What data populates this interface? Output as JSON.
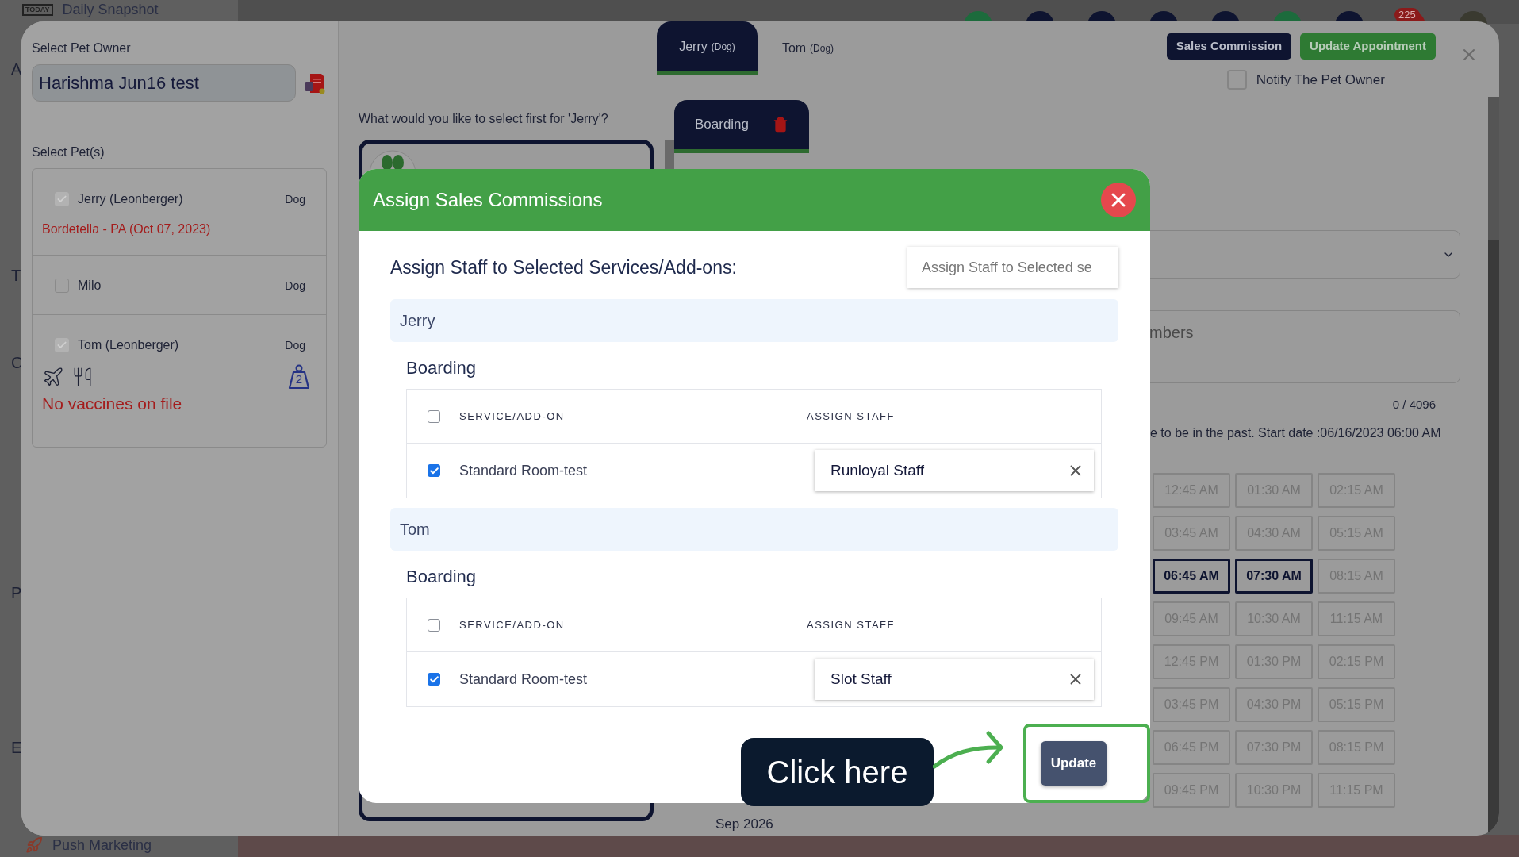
{
  "background": {
    "today_badge": "TODAY",
    "top_item": "Daily Snapshot",
    "sidebar_fragments": [
      "A",
      "T",
      "C",
      "P",
      "E"
    ],
    "bottom_item": "Push Marketing",
    "notification_count": "225"
  },
  "owner_panel": {
    "owner_label": "Select Pet Owner",
    "owner_value": "Harishma Jun16 test",
    "pets_label": "Select Pet(s)",
    "pets": [
      {
        "name": "Jerry (Leonberger)",
        "species": "Dog",
        "checked": true,
        "note": "Bordetella - PA (Oct 07, 2023)",
        "kind": "vaccinated"
      },
      {
        "name": "Milo",
        "species": "Dog",
        "checked": false,
        "kind": "basic"
      },
      {
        "name": "Tom (Leonberger)",
        "species": "Dog",
        "checked": true,
        "weight_badge": "2",
        "note": "No vaccines on file",
        "kind": "unvaccinated"
      }
    ]
  },
  "pet_tabs": [
    {
      "name": "Jerry",
      "species": "(Dog)",
      "selected": true
    },
    {
      "name": "Tom",
      "species": "(Dog)",
      "selected": false
    }
  ],
  "header_buttons": [
    {
      "label": "Sales Commission",
      "kind": "primary"
    },
    {
      "label": "Update Appointment",
      "kind": "success"
    }
  ],
  "notify": {
    "label": "Notify The Pet Owner",
    "checked": false
  },
  "question": "What would you like to select first for 'Jerry'?",
  "service_tabs": [
    {
      "label": "Boarding",
      "selected": true
    }
  ],
  "notes_placeholder": "mbers",
  "char_count": "0 / 4096",
  "warning": "e to be in the past. Start date :06/16/2023 06:00 AM",
  "time_slots": [
    {
      "label": "12:45 AM",
      "selected": false
    },
    {
      "label": "01:30 AM",
      "selected": false
    },
    {
      "label": "02:15 AM",
      "selected": false
    },
    {
      "label": "03:45 AM",
      "selected": false
    },
    {
      "label": "04:30 AM",
      "selected": false
    },
    {
      "label": "05:15 AM",
      "selected": false
    },
    {
      "label": "06:45 AM",
      "selected": true
    },
    {
      "label": "07:30 AM",
      "selected": true
    },
    {
      "label": "08:15 AM",
      "selected": false
    },
    {
      "label": "09:45 AM",
      "selected": false
    },
    {
      "label": "10:30 AM",
      "selected": false
    },
    {
      "label": "11:15 AM",
      "selected": false
    },
    {
      "label": "12:45 PM",
      "selected": false
    },
    {
      "label": "01:30 PM",
      "selected": false
    },
    {
      "label": "02:15 PM",
      "selected": false
    },
    {
      "label": "03:45 PM",
      "selected": false
    },
    {
      "label": "04:30 PM",
      "selected": false
    },
    {
      "label": "05:15 PM",
      "selected": false
    },
    {
      "label": "06:45 PM",
      "selected": false
    },
    {
      "label": "07:30 PM",
      "selected": false
    },
    {
      "label": "08:15 PM",
      "selected": false
    },
    {
      "label": "09:45 PM",
      "selected": false
    },
    {
      "label": "10:30 PM",
      "selected": false
    },
    {
      "label": "11:15 PM",
      "selected": false
    }
  ],
  "calendar_month": "Sep 2026",
  "modal": {
    "title": "Assign Sales Commissions",
    "heading": "Assign Staff to Selected Services/Add-ons:",
    "bulk_placeholder": "Assign Staff to Selected se",
    "sections": [
      {
        "pet": "Jerry",
        "service": "Boarding",
        "columns": [
          "SERVICE/ADD-ON",
          "ASSIGN STAFF"
        ],
        "select_all": false,
        "rows": [
          {
            "name": "Standard Room-test",
            "checked": true,
            "staff": "Runloyal Staff"
          }
        ]
      },
      {
        "pet": "Tom",
        "service": "Boarding",
        "columns": [
          "SERVICE/ADD-ON",
          "ASSIGN STAFF"
        ],
        "select_all": false,
        "rows": [
          {
            "name": "Standard Room-test",
            "checked": true,
            "staff": "Slot Staff"
          }
        ]
      }
    ],
    "submit": "Update"
  },
  "callout": "Click here"
}
